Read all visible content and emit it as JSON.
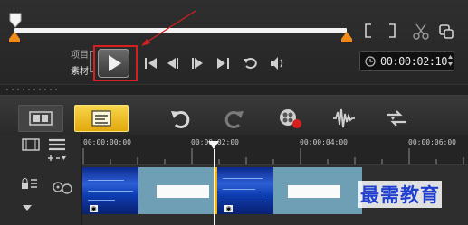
{
  "player": {
    "mode_project_label": "项目",
    "mode_clip_label": "素材",
    "timecode": "00:00:02:10",
    "icons": [
      "play-icon",
      "previous-icon",
      "step-back-icon",
      "step-forward-icon",
      "next-icon",
      "repeat-icon",
      "volume-icon",
      "mark-in-icon",
      "mark-out-icon",
      "split-icon",
      "enlarge-icon"
    ]
  },
  "timeline": {
    "ruler_labels": [
      "00:00:00:00",
      "00:00:02:00",
      "00:00:04:00",
      "00:00:06:00"
    ],
    "toolbar_icons": [
      "storyboard-view-icon",
      "timeline-view-icon",
      "undo-icon",
      "redo-icon",
      "record-capture-icon",
      "sound-mixer-icon",
      "auto-music-icon"
    ]
  },
  "watermark": "最需教育",
  "colors": {
    "highlight": "#d61f1f",
    "accent": "#f2b613",
    "clip": "#6e9fb4",
    "watermark": "#1f3fd0"
  }
}
